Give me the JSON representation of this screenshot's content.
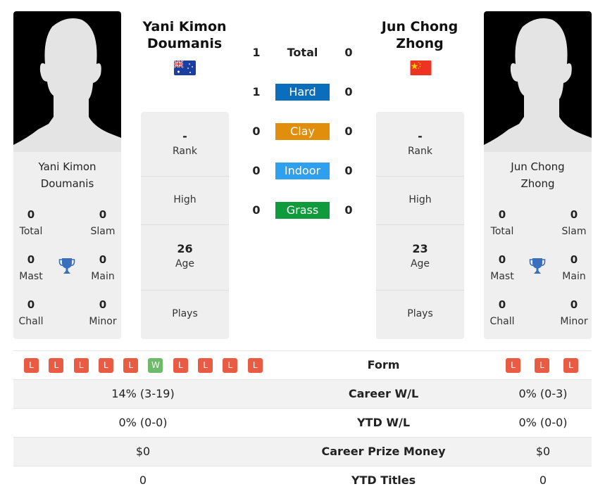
{
  "players": {
    "left": {
      "name": "Yani Kimon Doumanis",
      "name_line1": "Yani Kimon",
      "name_line2": "Doumanis",
      "country": "Australia",
      "flag_icon": "australia-flag-icon",
      "titles": {
        "total": {
          "value": "0",
          "label": "Total"
        },
        "slam": {
          "value": "0",
          "label": "Slam"
        },
        "mast": {
          "value": "0",
          "label": "Mast"
        },
        "main": {
          "value": "0",
          "label": "Main"
        },
        "chall": {
          "value": "0",
          "label": "Chall"
        },
        "minor": {
          "value": "0",
          "label": "Minor"
        }
      },
      "info": {
        "rank": {
          "value": "-",
          "label": "Rank"
        },
        "high": {
          "value": "",
          "label": "High"
        },
        "age": {
          "value": "26",
          "label": "Age"
        },
        "plays": {
          "value": "",
          "label": "Plays"
        }
      }
    },
    "right": {
      "name": "Jun Chong Zhong",
      "name_line1": "Jun Chong",
      "name_line2": "Zhong",
      "country": "China",
      "flag_icon": "china-flag-icon",
      "titles": {
        "total": {
          "value": "0",
          "label": "Total"
        },
        "slam": {
          "value": "0",
          "label": "Slam"
        },
        "mast": {
          "value": "0",
          "label": "Mast"
        },
        "main": {
          "value": "0",
          "label": "Main"
        },
        "chall": {
          "value": "0",
          "label": "Chall"
        },
        "minor": {
          "value": "0",
          "label": "Minor"
        }
      },
      "info": {
        "rank": {
          "value": "-",
          "label": "Rank"
        },
        "high": {
          "value": "",
          "label": "High"
        },
        "age": {
          "value": "23",
          "label": "Age"
        },
        "plays": {
          "value": "",
          "label": "Plays"
        }
      }
    }
  },
  "h2h": [
    {
      "label": "Total",
      "left": "1",
      "right": "0",
      "color": ""
    },
    {
      "label": "Hard",
      "left": "1",
      "right": "0",
      "color": "#0a6ebd"
    },
    {
      "label": "Clay",
      "left": "0",
      "right": "0",
      "color": "#e08e0b"
    },
    {
      "label": "Indoor",
      "left": "0",
      "right": "0",
      "color": "#2fa0f0"
    },
    {
      "label": "Grass",
      "left": "0",
      "right": "0",
      "color": "#0f9a3c"
    }
  ],
  "form": {
    "label": "Form",
    "left": [
      "L",
      "L",
      "L",
      "L",
      "L",
      "W",
      "L",
      "L",
      "L",
      "L"
    ],
    "right": [
      "L",
      "L",
      "L"
    ]
  },
  "stats": [
    {
      "label": "Career W/L",
      "left": "14% (3-19)",
      "right": "0% (0-3)"
    },
    {
      "label": "YTD W/L",
      "left": "0% (0-0)",
      "right": "0% (0-0)"
    },
    {
      "label": "Career Prize Money",
      "left": "$0",
      "right": "$0"
    },
    {
      "label": "YTD Titles",
      "left": "0",
      "right": "0"
    }
  ],
  "colors": {
    "loss": "#e95b43",
    "win": "#6cba6a",
    "trophy": "#3a6fbd"
  }
}
